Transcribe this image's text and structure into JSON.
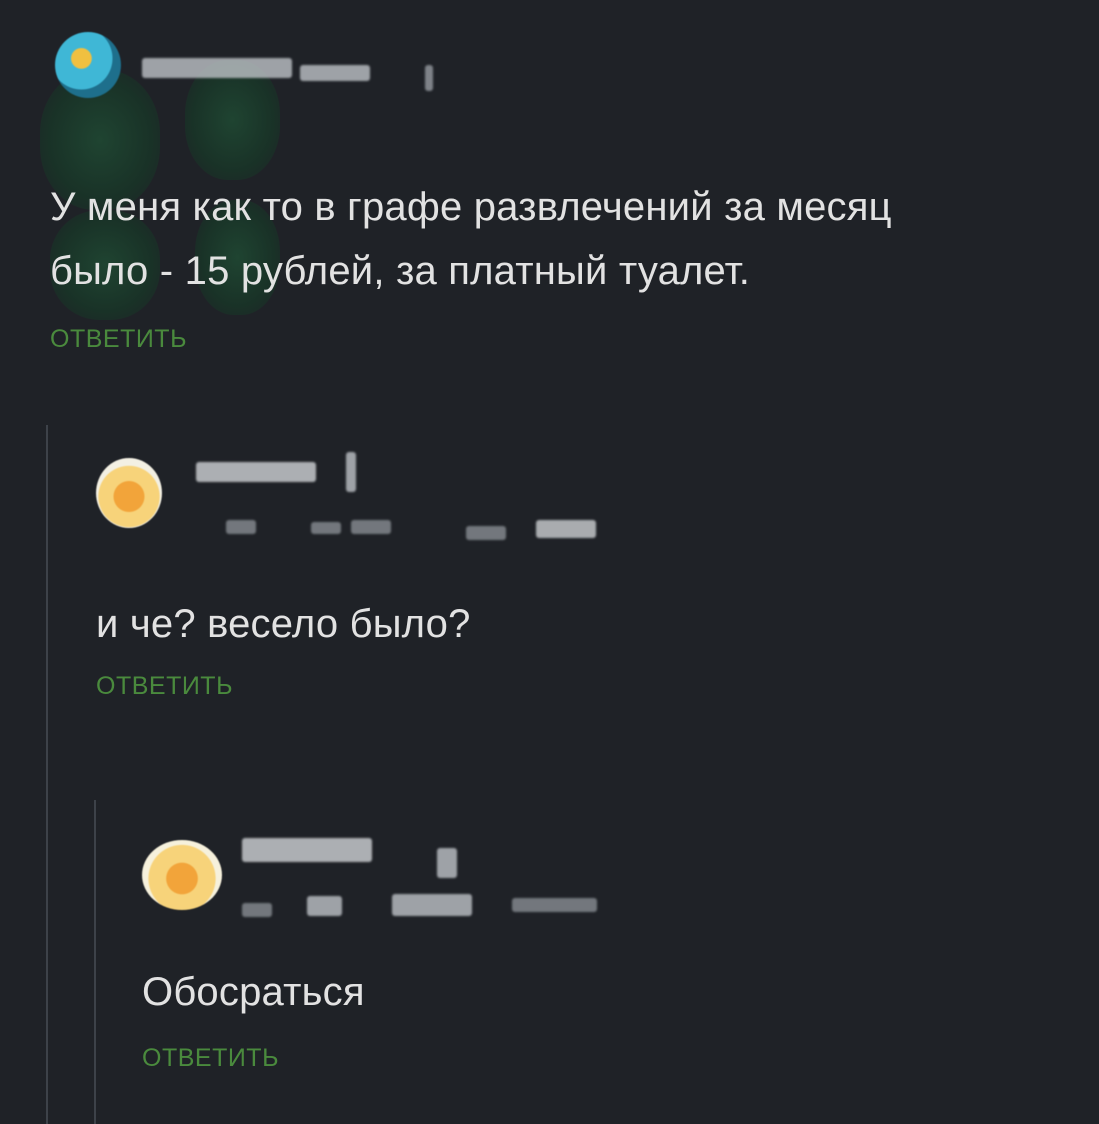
{
  "comments": [
    {
      "text_line1": "У меня как то в графе развлечений за месяц",
      "text_line2": "было - 15 рублей,  за платный туалет.",
      "reply_label": "ОТВЕТИТЬ"
    },
    {
      "text": "и че? весело было?",
      "reply_label": "ОТВЕТИТЬ"
    },
    {
      "text": "Обосраться",
      "reply_label": "ОТВЕТИТЬ"
    }
  ],
  "colors": {
    "background": "#1f2227",
    "reply_accent": "#4a8a3d",
    "text": "#e2e2e2",
    "thread_line": "#3d4249"
  }
}
